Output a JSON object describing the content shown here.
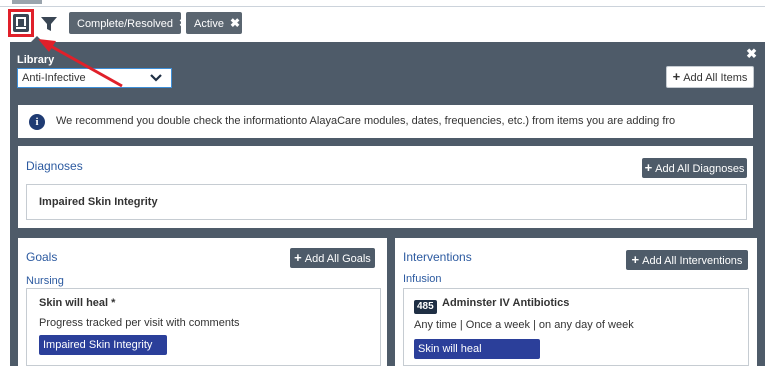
{
  "toolbar": {
    "filters": [
      {
        "label": "Complete/Resolved",
        "remove": "✖"
      },
      {
        "label": "Active",
        "remove": "✖"
      }
    ]
  },
  "library": {
    "label": "Library",
    "selected": "Anti-Infective",
    "add_all_items": "Add All Items",
    "close": "✖"
  },
  "notice": {
    "icon": "i",
    "text": "We recommend you double check the informationto AlayaCare modules, dates, frequencies, etc.) from items you are adding fro"
  },
  "diagnoses": {
    "title": "Diagnoses",
    "add_all": "Add All Diagnoses",
    "items": [
      "Impaired Skin Integrity"
    ]
  },
  "goals": {
    "title": "Goals",
    "add_all": "Add All Goals",
    "category": "Nursing",
    "item": {
      "name": "Skin will heal *",
      "detail": "Progress tracked per visit with comments",
      "tag": "Impaired Skin Integrity"
    }
  },
  "interventions": {
    "title": "Interventions",
    "add_all": "Add All Interventions",
    "category": "Infusion",
    "item": {
      "code": "485",
      "name": "Adminster IV Antibiotics",
      "detail": "Any time | Once a week | on any day of week",
      "tag": "Skin will heal"
    }
  },
  "colors": {
    "panel": "#4e5b69",
    "highlight": "#e0202a",
    "tag_blue": "#2b3f9a",
    "link_blue": "#2c5aa0"
  }
}
